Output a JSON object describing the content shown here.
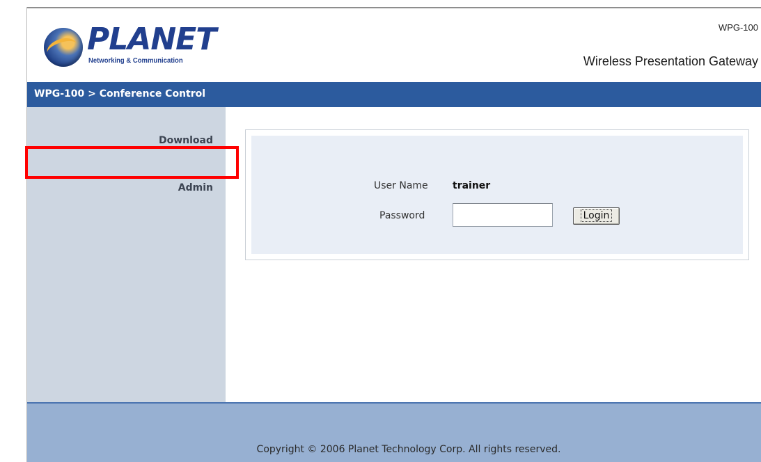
{
  "header": {
    "logo_text": "PLANET",
    "logo_tagline": "Networking & Communication",
    "product_model": "WPG-100",
    "product_name": "Wireless Presentation Gateway"
  },
  "breadcrumb": "WPG-100 > Conference Control",
  "sidebar": {
    "items": [
      {
        "label": "Download"
      },
      {
        "label": "Admin"
      }
    ]
  },
  "login": {
    "username_label": "User Name",
    "username_value": "trainer",
    "password_label": "Password",
    "password_value": "",
    "login_button": "Login"
  },
  "footer": {
    "copyright": "Copyright © 2006 Planet Technology Corp. All rights reserved."
  },
  "colors": {
    "title_bar": "#2c5b9e",
    "sidebar": "#cdd6e1",
    "footer": "#97b0d2",
    "highlight": "#ff0000"
  }
}
